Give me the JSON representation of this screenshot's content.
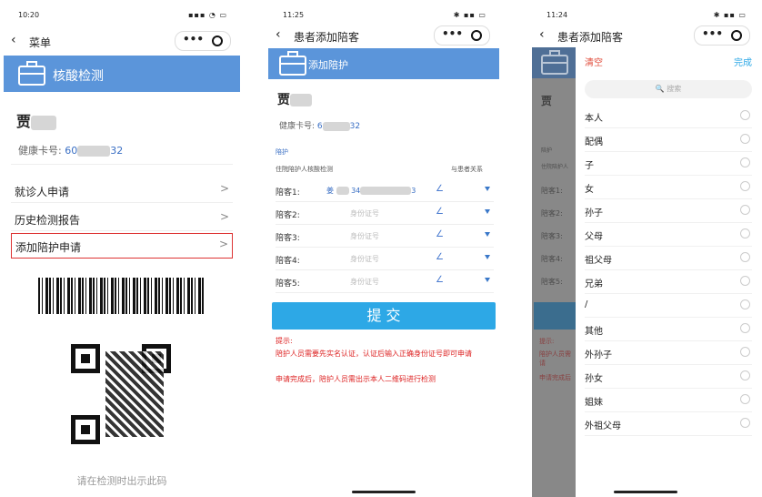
{
  "phone1": {
    "time": "10:20",
    "status_icons": "▪▪▪ ◔ ▭",
    "nav_title": "菜单",
    "capsule_dots": "•••",
    "banner_title": "核酸检测",
    "patient_name": "贾",
    "card_label": "健康卡号:",
    "card_prefix": "60",
    "card_suffix": "32",
    "menu": [
      {
        "label": "就诊人申请",
        "arrow": ">"
      },
      {
        "label": "历史检测报告",
        "arrow": ">"
      },
      {
        "label": "添加陪护申请",
        "arrow": ">"
      }
    ],
    "hint": "请在检测时出示此码"
  },
  "phone2": {
    "time": "11:25",
    "status_icons": "✱ ▪▪ ▭",
    "nav_title": "患者添加陪客",
    "capsule_dots": "•••",
    "banner_title": "添加陪护",
    "patient_name": "贾",
    "card_label": "健康卡号:",
    "card_prefix": "6",
    "card_suffix": "32",
    "section_title": "陪护",
    "col_left": "住院陪护人核酸检测",
    "col_right": "与患者关系",
    "companions": [
      {
        "label": "陪客1:",
        "value": "34",
        "value_suffix": "3",
        "value_prefix": "姜"
      },
      {
        "label": "陪客2:",
        "value": "身份证号"
      },
      {
        "label": "陪客3:",
        "value": "身份证号"
      },
      {
        "label": "陪客4:",
        "value": "身份证号"
      },
      {
        "label": "陪客5:",
        "value": "身份证号"
      }
    ],
    "pen_icon": "∠",
    "submit_label": "提 交",
    "tip_title": "提示:",
    "tip1": "陪护人员需要先实名认证，认证后输入正确身份证号即可申请",
    "tip2": "申请完成后，陪护人员需出示本人二维码进行检测"
  },
  "phone3": {
    "time": "11:24",
    "status_icons": "✱ ▪▪ ▭",
    "nav_title": "患者添加陪客",
    "capsule_dots": "•••",
    "clear_label": "清空",
    "done_label": "完成",
    "search_placeholder": "🔍 搜索",
    "bg_labels": [
      "陪护",
      "住院陪护人",
      "陪客1:",
      "陪客2:",
      "陪客3:",
      "陪客4:",
      "陪客5:",
      "提示:",
      "陪护人员需",
      "请",
      "申请完成后"
    ],
    "options": [
      "本人",
      "配偶",
      "子",
      "女",
      "孙子",
      "父母",
      "祖父母",
      "兄弟",
      "/",
      "其他",
      "外孙子",
      "孙女",
      "姐妹",
      "外祖父母"
    ]
  },
  "colors": {
    "banner": "#5b95da",
    "submit": "#2da8e6",
    "tip_red": "#d22222",
    "clear_red": "#e04b3a"
  }
}
